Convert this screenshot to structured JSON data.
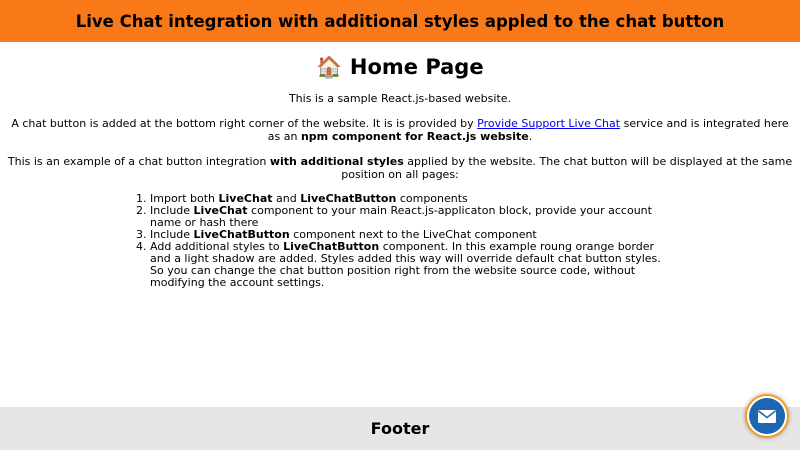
{
  "header": {
    "title": "Live Chat integration with additional styles appled to the chat button"
  },
  "main": {
    "heading_icon": "🏠",
    "heading": "Home Page",
    "p1": "This is a sample React.js-based website.",
    "p2": {
      "t1": "A chat button is added at the bottom right corner of the website. It is is provided by ",
      "link": "Provide Support Live Chat",
      "t2": " service and is integrated here as an ",
      "bold": "npm component for React.js website",
      "t3": "."
    },
    "p3": {
      "t1": "This is an example of a chat button integration ",
      "bold": "with additional styles",
      "t2": " applied by the website. The chat button will be displayed at the same position on all pages:"
    },
    "steps": [
      {
        "a": "Import both ",
        "b1": "LiveChat",
        "c": " and ",
        "b2": "LiveChatButton",
        "d": " components"
      },
      {
        "a": "Include ",
        "b1": "LiveChat",
        "c": " component to your main React.js-applicaton block, provide your account name or hash there"
      },
      {
        "a": "Include ",
        "b1": "LiveChatButton",
        "c": " component next to the LiveChat component"
      },
      {
        "a": "Add additional styles to ",
        "b1": "LiveChatButton",
        "c": " component. In this example roung orange border and a light shadow are added. Styles added this way will override default chat button styles. So you can change the chat button position right from the website source code, without modifying the account settings."
      }
    ]
  },
  "footer": {
    "title": "Footer"
  },
  "chat_button": {
    "icon": "envelope-icon"
  },
  "colors": {
    "header_bg": "#f97818",
    "footer_bg": "#e6e6e6",
    "chat_border": "#f59e1c",
    "chat_fill": "#1d66b2"
  }
}
